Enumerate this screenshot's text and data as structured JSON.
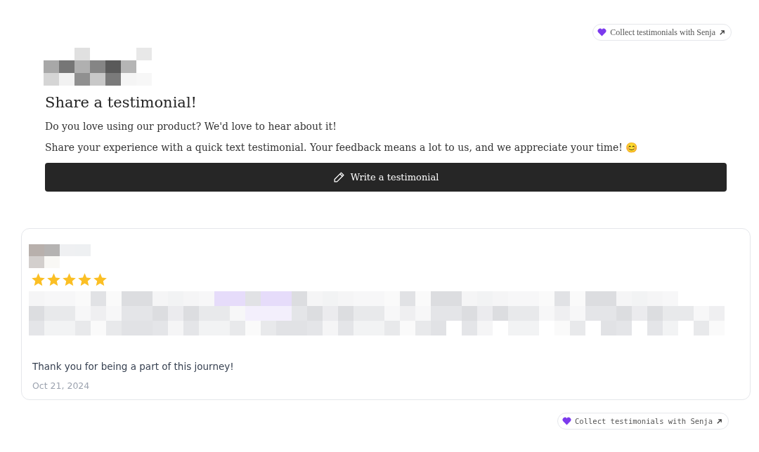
{
  "top_badge": {
    "label": "Collect testimonials with Senja"
  },
  "header": {
    "title": "Share a testimonial!",
    "intro": "Do you love using our product? We'd love to hear about it!",
    "body": "Share your experience with a quick text testimonial. Your feedback means a lot to us, and we appreciate your time! 😊"
  },
  "write_button": {
    "label": "Write a testimonial"
  },
  "testimonial": {
    "stars": 5,
    "closing": "Thank you for being a part of this journey!",
    "date": "Oct 21, 2024"
  },
  "bottom_badge": {
    "label": "Collect testimonials with Senja"
  }
}
